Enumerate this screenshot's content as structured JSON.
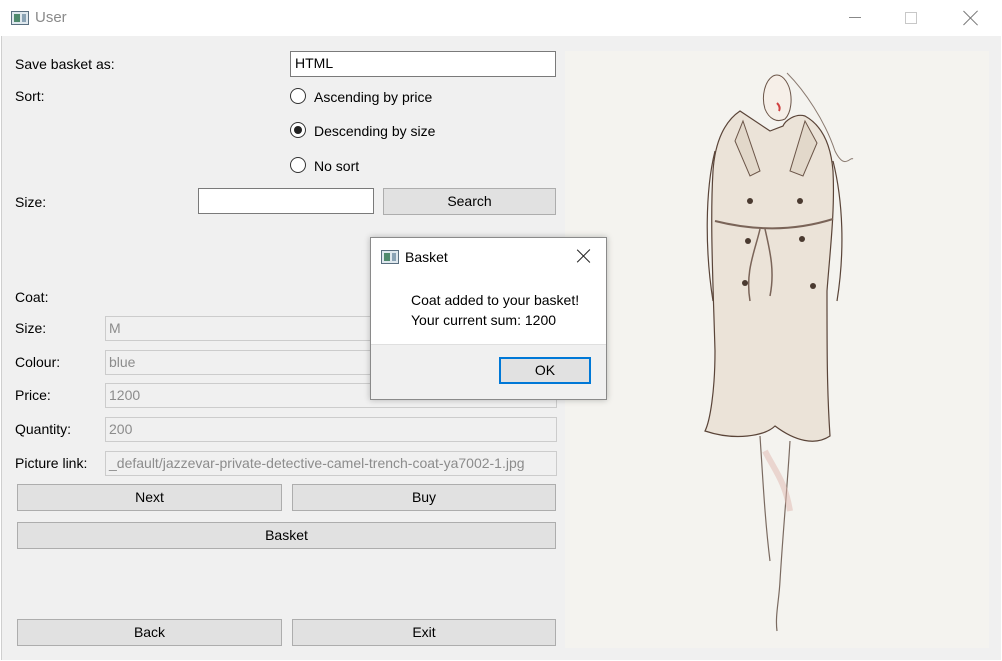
{
  "window": {
    "title": "User"
  },
  "form": {
    "save_label": "Save basket as:",
    "save_value": "HTML",
    "sort_label": "Sort:",
    "sort_options": [
      "Ascending by price",
      "Descending by size",
      "No sort"
    ],
    "sort_selected": "Descending by size",
    "size_search_label": "Size:",
    "size_search_value": "",
    "search_button": "Search"
  },
  "coat": {
    "section_label": "Coat:",
    "size_label": "Size:",
    "size_value": "M",
    "colour_label": "Colour:",
    "colour_value": "blue",
    "price_label": "Price:",
    "price_value": "1200",
    "quantity_label": "Quantity:",
    "quantity_value": "200",
    "picture_label": "Picture link:",
    "picture_value": "_default/jazzevar-private-detective-camel-trench-coat-ya7002-1.jpg"
  },
  "buttons": {
    "next": "Next",
    "buy": "Buy",
    "basket": "Basket",
    "back": "Back",
    "exit": "Exit"
  },
  "dialog": {
    "title": "Basket",
    "line1": "Coat added to your basket!",
    "line2": "Your current sum: 1200",
    "ok": "OK"
  },
  "icons": [
    "app-icon",
    "minimize-icon",
    "maximize-icon",
    "close-icon"
  ]
}
